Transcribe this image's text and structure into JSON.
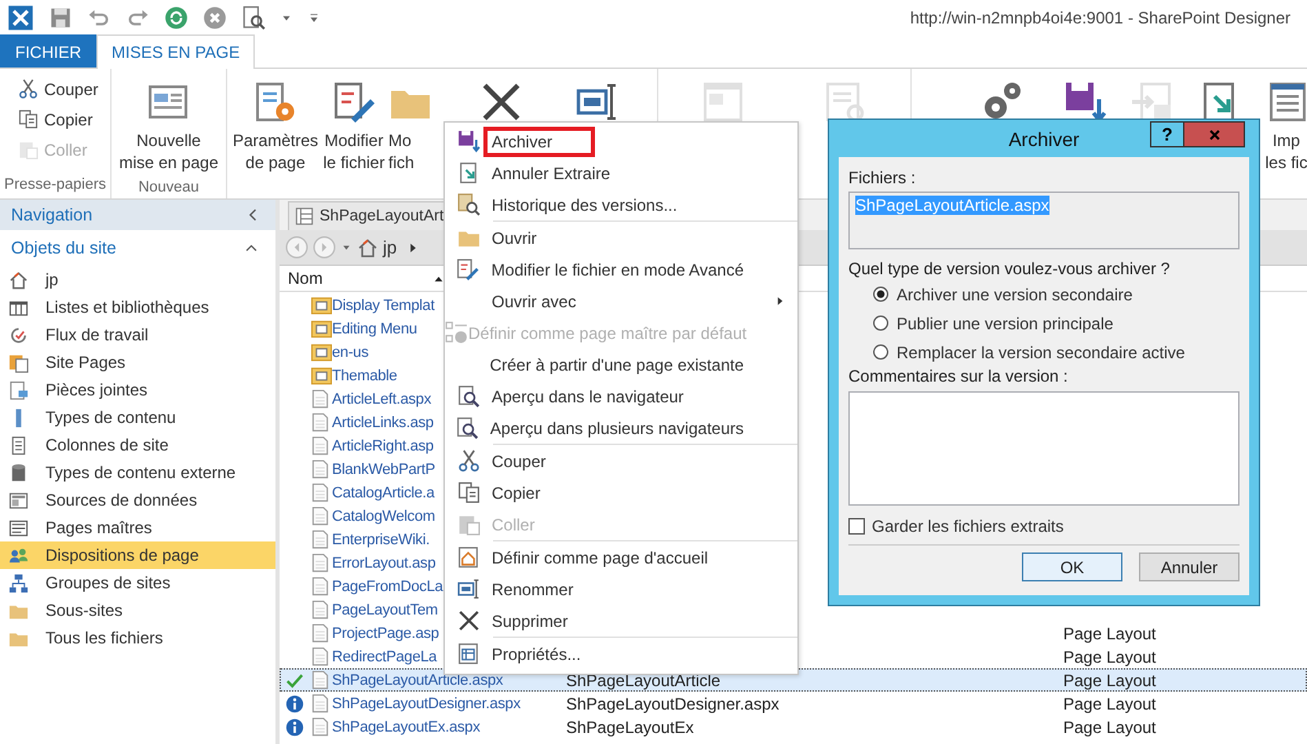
{
  "window": {
    "title": "http://win-n2mnpb4oi4e:9001 - SharePoint Designer"
  },
  "tabs": [
    {
      "label": "FICHIER",
      "kind": "file",
      "selected": false
    },
    {
      "label": "MISES EN PAGE",
      "kind": "tab",
      "selected": true
    }
  ],
  "ribbon": {
    "groups": [
      {
        "label": "Presse-papiers",
        "buttons": [
          {
            "kind": "small",
            "label": "Couper",
            "disabled": false
          },
          {
            "kind": "small",
            "label": "Copier",
            "disabled": false
          },
          {
            "kind": "small",
            "label": "Coller",
            "disabled": true
          }
        ]
      },
      {
        "label": "Nouveau",
        "buttons": [
          {
            "kind": "large",
            "lines": [
              "Nouvelle",
              "mise en page"
            ],
            "disabled": false
          }
        ]
      },
      {
        "buttons": [
          {
            "kind": "large",
            "lines": [
              "Paramètres",
              "de page"
            ],
            "disabled": false
          },
          {
            "kind": "large",
            "lines": [
              "Modifier",
              "le fichier"
            ],
            "disabled": false
          },
          {
            "kind": "large",
            "lines": [
              "Mo",
              "fich"
            ],
            "disabled": false
          },
          {
            "kind": "large",
            "disabled": false
          },
          {
            "kind": "large",
            "disabled": false
          }
        ]
      },
      {
        "buttons": [
          {
            "kind": "large",
            "disabled": true
          },
          {
            "kind": "large",
            "disabled": true
          }
        ]
      },
      {
        "buttons": [
          {
            "kind": "large",
            "disabled": false
          },
          {
            "kind": "large",
            "disabled": false
          },
          {
            "kind": "large",
            "disabled": true
          },
          {
            "kind": "large",
            "disabled": false
          },
          {
            "kind": "large",
            "lines": [
              "Imp",
              "les fic"
            ],
            "disabled": false
          }
        ]
      }
    ]
  },
  "navigation": {
    "title": "Navigation",
    "section_title": "Objets du site",
    "expanded": true,
    "items": [
      {
        "label": "jp",
        "selected": false
      },
      {
        "label": "Listes et bibliothèques",
        "selected": false
      },
      {
        "label": "Flux de travail",
        "selected": false
      },
      {
        "label": "Site Pages",
        "selected": false
      },
      {
        "label": "Pièces jointes",
        "selected": false
      },
      {
        "label": "Types de contenu",
        "selected": false
      },
      {
        "label": "Colonnes de site",
        "selected": false
      },
      {
        "label": "Types de contenu externe",
        "selected": false
      },
      {
        "label": "Sources de données",
        "selected": false
      },
      {
        "label": "Pages maîtres",
        "selected": false
      },
      {
        "label": "Dispositions de page",
        "selected": true
      },
      {
        "label": "Groupes de sites",
        "selected": false
      },
      {
        "label": "Sous-sites",
        "selected": false
      },
      {
        "label": "Tous les fichiers",
        "selected": false
      }
    ]
  },
  "document": {
    "tab": "ShPageLayoutArt",
    "breadcrumb": [
      "jp"
    ],
    "columns": [
      "Nom"
    ],
    "rows": [
      {
        "name": "Display Templat",
        "kind": "folder",
        "checked_out": false,
        "info": false,
        "selected": false
      },
      {
        "name": "Editing Menu",
        "kind": "folder",
        "checked_out": false,
        "info": false,
        "selected": false
      },
      {
        "name": "en-us",
        "kind": "folder",
        "checked_out": false,
        "info": false,
        "selected": false
      },
      {
        "name": "Themable",
        "kind": "folder",
        "checked_out": false,
        "info": false,
        "selected": false
      },
      {
        "name": "ArticleLeft.aspx",
        "kind": "file",
        "checked_out": false,
        "info": false,
        "selected": false
      },
      {
        "name": "ArticleLinks.asp",
        "kind": "file",
        "checked_out": false,
        "info": false,
        "selected": false
      },
      {
        "name": "ArticleRight.asp",
        "kind": "file",
        "checked_out": false,
        "info": false,
        "selected": false
      },
      {
        "name": "BlankWebPartP",
        "kind": "file",
        "checked_out": false,
        "info": false,
        "selected": false
      },
      {
        "name": "CatalogArticle.a",
        "kind": "file",
        "checked_out": false,
        "info": false,
        "selected": false
      },
      {
        "name": "CatalogWelcom",
        "kind": "file",
        "checked_out": false,
        "info": false,
        "selected": false
      },
      {
        "name": "EnterpriseWiki.",
        "kind": "file",
        "checked_out": false,
        "info": false,
        "selected": false
      },
      {
        "name": "ErrorLayout.asp",
        "kind": "file",
        "checked_out": false,
        "info": false,
        "selected": false
      },
      {
        "name": "PageFromDocLa",
        "kind": "file",
        "checked_out": false,
        "info": false,
        "selected": false
      },
      {
        "name": "PageLayoutTem",
        "kind": "file",
        "checked_out": false,
        "info": false,
        "selected": false
      },
      {
        "name": "ProjectPage.asp",
        "kind": "file",
        "type": "Page Layout",
        "checked_out": false,
        "info": false,
        "selected": false
      },
      {
        "name": "RedirectPageLa",
        "kind": "file",
        "type": "Page Layout",
        "checked_out": false,
        "info": false,
        "selected": false
      },
      {
        "name": "ShPageLayoutArticle.aspx",
        "kind": "file",
        "title": "ShPageLayoutArticle",
        "type": "Page Layout",
        "checked_out": true,
        "info": false,
        "selected": true
      },
      {
        "name": "ShPageLayoutDesigner.aspx",
        "kind": "file",
        "title": "ShPageLayoutDesigner.aspx",
        "type": "Page Layout",
        "checked_out": false,
        "info": true,
        "selected": false
      },
      {
        "name": "ShPageLayoutEx.aspx",
        "kind": "file",
        "title": "ShPageLayoutEx",
        "type": "Page Layout",
        "checked_out": false,
        "info": true,
        "selected": false
      }
    ]
  },
  "context_menu": {
    "items": [
      {
        "kind": "item",
        "label": "Archiver",
        "highlighted": true,
        "disabled": false,
        "submenu": false
      },
      {
        "kind": "item",
        "label": "Annuler Extraire",
        "highlighted": false,
        "disabled": false,
        "submenu": false
      },
      {
        "kind": "item",
        "label": "Historique des versions...",
        "highlighted": false,
        "disabled": false,
        "submenu": false
      },
      {
        "kind": "separator"
      },
      {
        "kind": "item",
        "label": "Ouvrir",
        "highlighted": false,
        "disabled": false,
        "submenu": false
      },
      {
        "kind": "item",
        "label": "Modifier le fichier en mode Avancé",
        "highlighted": false,
        "disabled": false,
        "submenu": false
      },
      {
        "kind": "item",
        "label": "Ouvrir avec",
        "highlighted": false,
        "disabled": false,
        "submenu": true
      },
      {
        "kind": "item",
        "label": "Définir comme page maître par défaut",
        "highlighted": false,
        "disabled": true,
        "submenu": false
      },
      {
        "kind": "item",
        "label": "Créer à partir d'une page existante",
        "highlighted": false,
        "disabled": false,
        "submenu": false
      },
      {
        "kind": "item",
        "label": "Aperçu dans le navigateur",
        "highlighted": false,
        "disabled": false,
        "submenu": false
      },
      {
        "kind": "item",
        "label": "Aperçu dans plusieurs navigateurs",
        "highlighted": false,
        "disabled": false,
        "submenu": false
      },
      {
        "kind": "separator"
      },
      {
        "kind": "item",
        "label": "Couper",
        "highlighted": false,
        "disabled": false,
        "submenu": false
      },
      {
        "kind": "item",
        "label": "Copier",
        "highlighted": false,
        "disabled": false,
        "submenu": false
      },
      {
        "kind": "item",
        "label": "Coller",
        "highlighted": false,
        "disabled": true,
        "submenu": false
      },
      {
        "kind": "separator"
      },
      {
        "kind": "item",
        "label": "Définir comme page d'accueil",
        "highlighted": false,
        "disabled": false,
        "submenu": false
      },
      {
        "kind": "item",
        "label": "Renommer",
        "highlighted": false,
        "disabled": false,
        "submenu": false
      },
      {
        "kind": "item",
        "label": "Supprimer",
        "highlighted": false,
        "disabled": false,
        "submenu": false
      },
      {
        "kind": "separator"
      },
      {
        "kind": "item",
        "label": "Propriétés...",
        "highlighted": false,
        "disabled": false,
        "submenu": false
      }
    ]
  },
  "dialog": {
    "title": "Archiver",
    "help": "?",
    "files_label": "Fichiers :",
    "files": [
      {
        "name": "ShPageLayoutArticle.aspx",
        "selected": true
      }
    ],
    "question": "Quel type de version voulez-vous archiver ?",
    "options": [
      {
        "label": "Archiver une version secondaire",
        "selected": true
      },
      {
        "label": "Publier une version principale",
        "selected": false
      },
      {
        "label": "Remplacer la version secondaire active",
        "selected": false
      }
    ],
    "comments_label": "Commentaires sur la version :",
    "keep_checked_out": {
      "label": "Garder les fichiers extraits",
      "checked": false
    },
    "buttons": [
      {
        "label": "OK",
        "default": true
      },
      {
        "label": "Annuler",
        "default": false
      }
    ]
  }
}
